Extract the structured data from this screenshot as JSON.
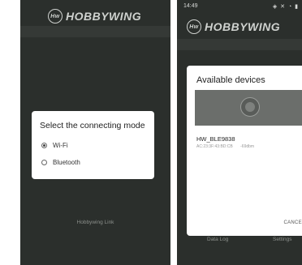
{
  "left": {
    "logo": "HOBBYWING",
    "logo_mark": "Hw",
    "dialog_title": "Select the connecting mode",
    "options": [
      "Wi-Fi",
      "Bluetooth"
    ],
    "footer": "Hobbywing Link"
  },
  "right": {
    "status_time": "14:49",
    "logo": "HOBBYWING",
    "logo_mark": "Hw",
    "dialog_title": "Available devices",
    "device": {
      "name": "HW_BLE9838",
      "address": "AC:23:3F:43:BD:CB",
      "signal": "-69dbm"
    },
    "cancel_label": "CANCE",
    "nav": [
      "Data Log",
      "Settings"
    ]
  }
}
